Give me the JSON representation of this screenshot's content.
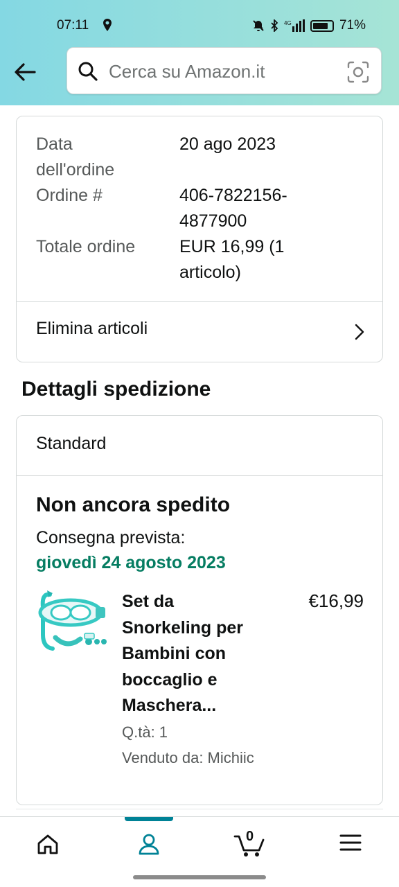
{
  "status_bar": {
    "time": "07:11",
    "battery": "71%"
  },
  "search": {
    "placeholder": "Cerca su Amazon.it"
  },
  "order": {
    "date_label": "Data\ndell'ordine",
    "date_value": "20 ago 2023",
    "number_label": "Ordine #",
    "number_value": "406-7822156-\n4877900",
    "total_label": "Totale ordine",
    "total_value": "EUR 16,99 (1\narticolo)",
    "remove_items_label": "Elimina articoli"
  },
  "shipping": {
    "section_title": "Dettagli spedizione",
    "method": "Standard",
    "status": "Non ancora spedito",
    "delivery_label": "Consegna prevista:",
    "delivery_date": "giovedì 24 agosto 2023",
    "item": {
      "title": "Set da\nSnorkeling per\nBambini con\nboccaglio e\nMaschera...",
      "price": "€16,99",
      "quantity": "Q.tà: 1",
      "seller": "Venduto da: Michiic"
    }
  },
  "nav": {
    "active": "account",
    "cart_count": "0"
  },
  "colors": {
    "header_gradient_start": "#84d8e3",
    "header_gradient_end": "#a6e4d6",
    "delivery_green": "#067d62",
    "nav_accent": "#008296"
  }
}
